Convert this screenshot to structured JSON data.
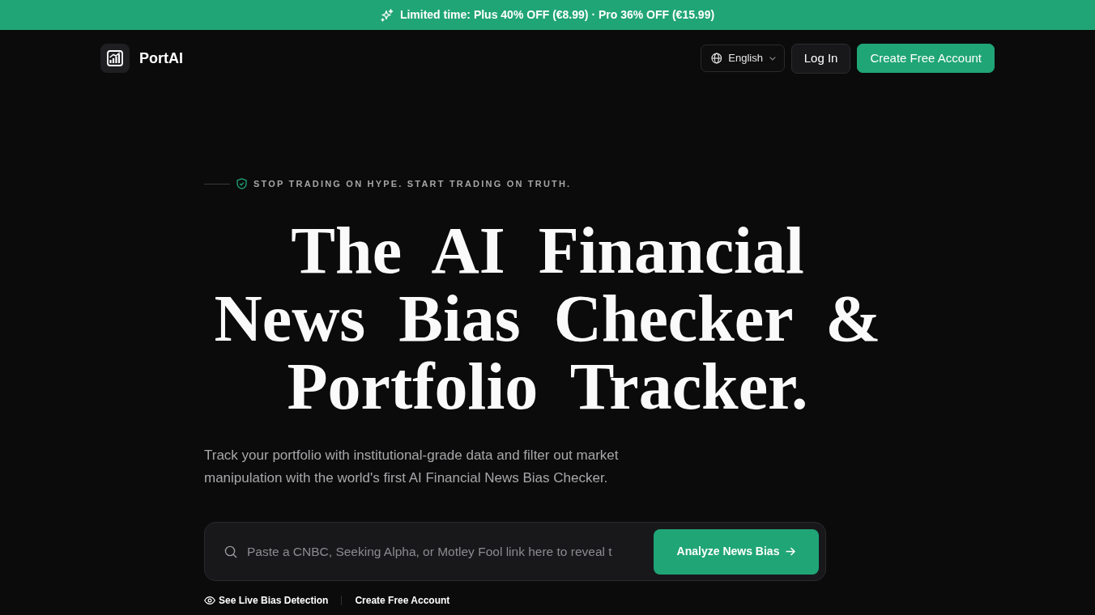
{
  "promo_banner": {
    "text": "Limited time: Plus 40% OFF (€8.99) · Pro 36% OFF (€15.99)"
  },
  "navbar": {
    "brand": "PortAI",
    "language": {
      "label": "English"
    },
    "buttons": [
      {
        "label": "Log In",
        "kind": "secondary"
      },
      {
        "label": "Create Free Account",
        "kind": "primary"
      }
    ]
  },
  "hero": {
    "eyebrow": "STOP TRADING ON HYPE. START TRADING ON TRUTH.",
    "headline": "The AI Financial News Bias Checker & Portfolio Tracker.",
    "subtitle": "Track your portfolio with institutional-grade data and filter out market manipulation with the world's first AI Financial News Bias Checker.",
    "search": {
      "placeholder": "Paste a CNBC, Seeking Alpha, or Motley Fool link here to reveal t",
      "button": "Analyze News Bias"
    },
    "links": [
      {
        "label": "See Live Bias Detection",
        "kind": "icon"
      },
      {
        "label": "Create Free Account",
        "kind": "plain"
      }
    ]
  }
}
